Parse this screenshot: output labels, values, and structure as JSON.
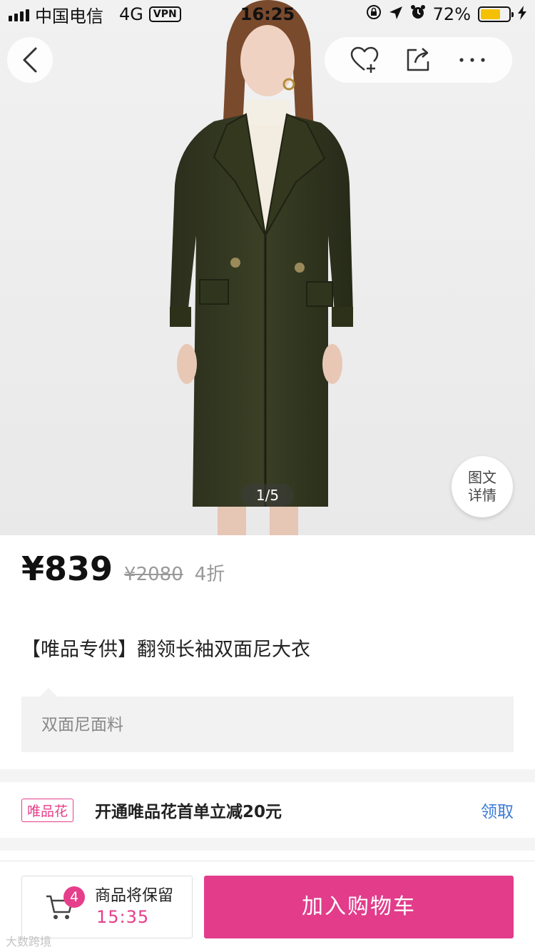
{
  "status_bar": {
    "carrier": "中国电信",
    "network": "4G",
    "vpn": "VPN",
    "time": "16:25",
    "battery_percent": "72%",
    "battery_level": 0.72
  },
  "gallery": {
    "pager": "1/5",
    "detail_button_line1": "图文",
    "detail_button_line2": "详情"
  },
  "price": {
    "current": "¥839",
    "original": "¥2080",
    "discount": "4折"
  },
  "product": {
    "title": "【唯品专供】翻领长袖双面尼大衣",
    "tip": "双面尼面料"
  },
  "promo": {
    "tag": "唯品花",
    "text": "开通唯品花首单立减20元",
    "link": "领取"
  },
  "bottom_bar": {
    "cart_count": "4",
    "cart_hold_text": "商品将保留",
    "cart_timer": "15:35",
    "add_to_cart": "加入购物车"
  },
  "watermark": "大数跨境",
  "colors": {
    "accent": "#e23c8b",
    "link": "#3d7bd6",
    "battery": "#f5c000"
  }
}
